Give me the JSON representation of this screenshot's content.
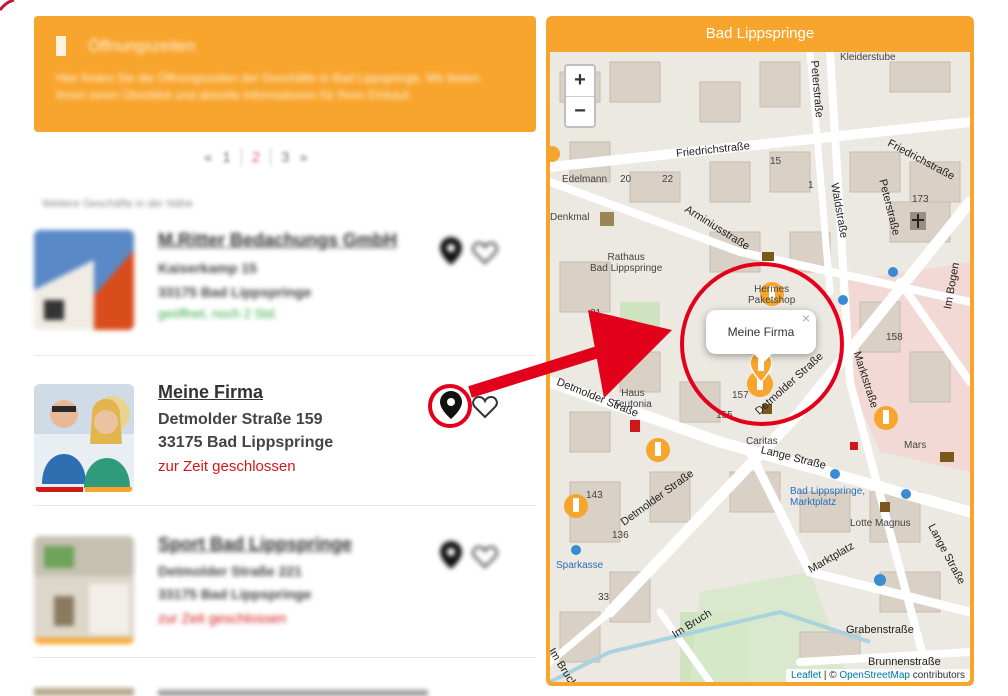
{
  "notice": {
    "title": "Öffnungszeiten",
    "text": "Hier finden Sie die Öffnungszeiten der Geschäfte in Bad Lippspringe. Wir bieten Ihnen einen Überblick und aktuelle Informationen für Ihren Einkauf."
  },
  "pagination": {
    "prev": "«",
    "pages": [
      "1",
      "2",
      "3"
    ],
    "active_index": 1,
    "next": "»"
  },
  "results_label": "Weitere Geschäfte in der Nähe",
  "entries": [
    {
      "name": "M.Ritter Bedachungs GmbH",
      "street": "Kaiserkamp 15",
      "city": "33175 Bad Lippspringe",
      "status": "geöffnet, noch 2 Std.",
      "status_color": "#3aa84a",
      "blurred": true
    },
    {
      "name": "Meine Firma",
      "street": "Detmolder Straße 159",
      "city": "33175 Bad Lippspringe",
      "status": "zur Zeit geschlossen",
      "status_color": "#d01818",
      "blurred": false
    },
    {
      "name": "Sport Bad Lippspringe",
      "street": "Detmolder Straße 221",
      "city": "33175 Bad Lippspringe",
      "status": "zur Zeit geschlossen",
      "status_color": "#d01818",
      "blurred": true
    }
  ],
  "icons": {
    "location": "map-pin-icon",
    "favorite": "heart-icon"
  },
  "colors": {
    "accent": "#f8a52e",
    "annotation": "#e3001b",
    "closed": "#d01818"
  },
  "map": {
    "title": "Bad Lippspringe",
    "zoom_in": "+",
    "zoom_out": "−",
    "popup_text": "Meine Firma",
    "popup_close": "×",
    "attribution_leaflet": "Leaflet",
    "attribution_sep": " | © ",
    "attribution_osm": "OpenStreetMap",
    "attribution_tail": " contributors",
    "labels": {
      "kleiderstube": "Kleiderstube",
      "peterstrasse_top": "Peterstraße",
      "friedrichstrasse_left": "Friedrichstraße",
      "friedrichstrasse_right": "Friedrichstraße",
      "edelmann": "Edelmann",
      "denkmal": "Denkmal",
      "rathaus": "Rathaus\nBad Lippspringe",
      "arminiusstrasse": "Arminiusstraße",
      "waldstrasse": "Waldstraße",
      "peterstrasse_mid": "Peterstraße",
      "hermes": "Hermes\nPaketshop",
      "im_bogen": "Im Bogen",
      "marktstrasse": "Marktstraße",
      "haus_teutonia": "Haus\nTeutonia",
      "detmolder_left": "Detmolder Straße",
      "detmolder_mid": "Detmolder Straße",
      "detmolder_bottom": "Detmolder Straße",
      "caritas": "Caritas",
      "lange_strasse": "Lange Straße",
      "lange_strasse_right": "Lange Straße",
      "marktplatz_stop": "Bad Lippspringe,\nMarktplatz",
      "lotte": "Lotte Magnus",
      "marktplatz": "Marktplatz",
      "sparkasse": "Sparkasse",
      "grabenstrasse": "Grabenstraße",
      "im_bruch": "Im Bruch",
      "im_bruch_left": "Im Bruch",
      "brunnenstrasse": "Brunnenstraße",
      "mars": "Mars",
      "n_157": "157",
      "n_155": "155",
      "n_158": "158",
      "n_173": "173",
      "n_31": "31",
      "n_20": "20",
      "n_22": "22",
      "n_15": "15",
      "n_1": "1",
      "n_143": "143",
      "n_136": "136",
      "n_33": "33"
    }
  }
}
